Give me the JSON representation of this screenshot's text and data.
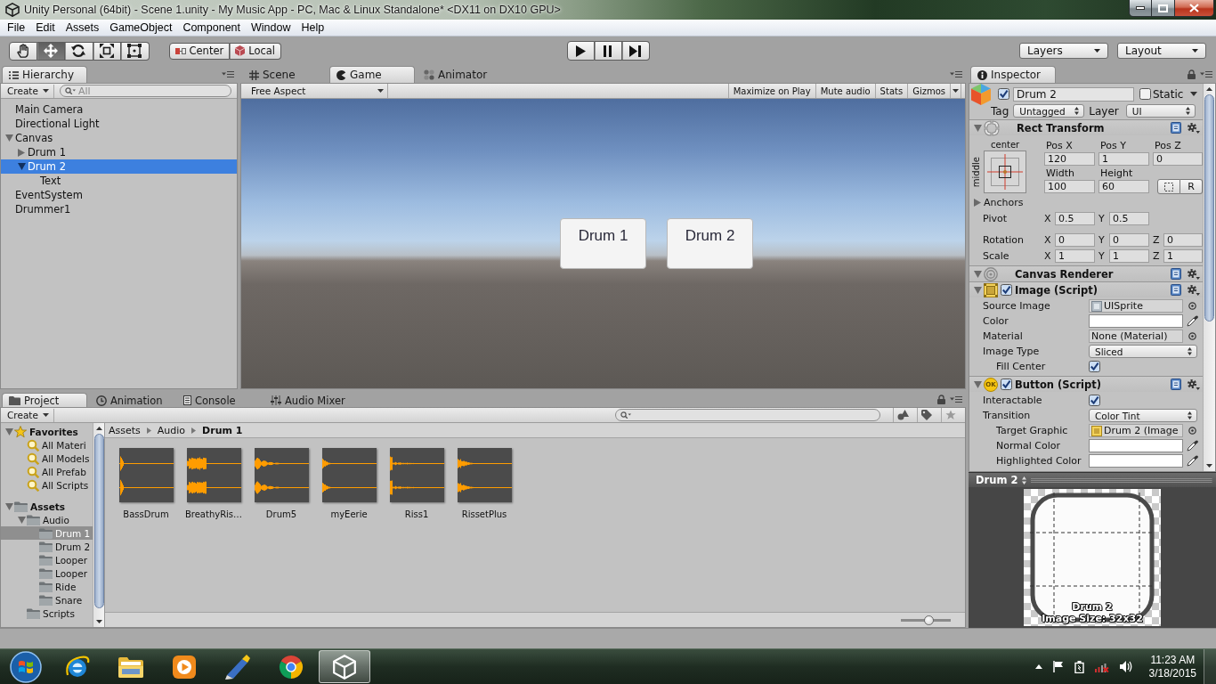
{
  "window": {
    "title": "Unity Personal (64bit) - Scene 1.unity - My Music App - PC, Mac & Linux Standalone* <DX11 on DX10 GPU>"
  },
  "menu_bar": [
    "File",
    "Edit",
    "Assets",
    "GameObject",
    "Component",
    "Window",
    "Help"
  ],
  "toolbar": {
    "tools": [
      {
        "kind": "hand",
        "selected": false
      },
      {
        "kind": "move",
        "selected": true
      },
      {
        "kind": "rotate",
        "selected": false
      },
      {
        "kind": "scale",
        "selected": false
      },
      {
        "kind": "rect",
        "selected": false
      }
    ],
    "pivot_mode": "Center",
    "pivot_rotation": "Local",
    "playback": [
      {
        "kind": "play"
      },
      {
        "kind": "pause"
      },
      {
        "kind": "step"
      }
    ],
    "layers": "Layers",
    "layout": "Layout"
  },
  "hierarchy": {
    "tab": "Hierarchy",
    "create": "Create",
    "search": {
      "placeholder": "All"
    },
    "items": [
      {
        "label": "Main Camera",
        "selected": false
      },
      {
        "label": "Directional Light",
        "selected": false
      },
      {
        "label": "Canvas",
        "selected": false,
        "expanded": true,
        "children": [
          {
            "label": "Drum 1",
            "selected": false,
            "expanded": false
          },
          {
            "label": "Drum 2",
            "selected": true,
            "expanded": true,
            "children": [
              {
                "label": "Text",
                "selected": false
              }
            ]
          }
        ]
      },
      {
        "label": "EventSystem",
        "selected": false
      },
      {
        "label": "Drummer1",
        "selected": false
      }
    ]
  },
  "center_panel": {
    "tabs": [
      {
        "kind": "scene",
        "label": "Scene",
        "selected": false
      },
      {
        "kind": "game",
        "label": "Game",
        "selected": true
      },
      {
        "kind": "animator",
        "label": "Animator",
        "selected": false
      }
    ],
    "aspect": "Free Aspect",
    "options": [
      "Maximize on Play",
      "Mute audio",
      "Stats",
      "Gizmos"
    ],
    "game_buttons": [
      "Drum 1",
      "Drum 2"
    ]
  },
  "inspector": {
    "tab": "Inspector",
    "object": {
      "active": true,
      "name": "Drum 2",
      "static": false,
      "static_label": "Static",
      "tag_label": "Tag",
      "tag": "Untagged",
      "layer_label": "Layer",
      "layer": "UI"
    },
    "rect_transform": {
      "title": "Rect Transform",
      "expanded": true,
      "anchor_horizontal": "center",
      "anchor_vertical": "middle",
      "pos_fields": [
        {
          "label": "Pos X",
          "value": "120"
        },
        {
          "label": "Pos Y",
          "value": "1"
        },
        {
          "label": "Pos Z",
          "value": "0"
        }
      ],
      "size_fields": [
        {
          "label": "Width",
          "value": "100"
        },
        {
          "label": "Height",
          "value": "60"
        }
      ],
      "raw_button": "R",
      "anchors": {
        "label": "Anchors",
        "expanded": false
      },
      "vectors": [
        {
          "label": "Pivot",
          "fields": [
            {
              "axis": "X",
              "value": "0.5"
            },
            {
              "axis": "Y",
              "value": "0.5"
            }
          ]
        },
        {
          "label": "Rotation",
          "fields": [
            {
              "axis": "X",
              "value": "0"
            },
            {
              "axis": "Y",
              "value": "0"
            },
            {
              "axis": "Z",
              "value": "0"
            }
          ]
        },
        {
          "label": "Scale",
          "fields": [
            {
              "axis": "X",
              "value": "1"
            },
            {
              "axis": "Y",
              "value": "1"
            },
            {
              "axis": "Z",
              "value": "1"
            }
          ]
        }
      ]
    },
    "components": [
      {
        "kind": "canvas_renderer",
        "title": "Canvas Renderer",
        "expanded": true
      },
      {
        "kind": "image",
        "title": "Image (Script)",
        "expanded": true,
        "enabled": true,
        "properties": [
          {
            "kind": "sprite",
            "label": "Source Image",
            "value": "UISprite"
          },
          {
            "kind": "color",
            "label": "Color",
            "color": "#ffffff"
          },
          {
            "kind": "object",
            "label": "Material",
            "value": "None (Material)"
          },
          {
            "kind": "dropdown",
            "label": "Image Type",
            "value": "Sliced",
            "children": [
              {
                "kind": "checkbox",
                "label": "Fill Center",
                "checked": true
              }
            ]
          }
        ]
      },
      {
        "kind": "button",
        "title": "Button (Script)",
        "badge": "OK",
        "expanded": true,
        "enabled": true,
        "properties": [
          {
            "kind": "checkbox",
            "label": "Interactable",
            "checked": true
          },
          {
            "kind": "dropdown",
            "label": "Transition",
            "value": "Color Tint",
            "children": [
              {
                "kind": "reference",
                "label": "Target Graphic",
                "value": "Drum 2 (Image"
              },
              {
                "kind": "color",
                "label": "Normal Color",
                "color": "#ffffff"
              },
              {
                "kind": "color",
                "label": "Highlighted Color",
                "color": "#ffffff"
              }
            ]
          }
        ]
      }
    ]
  },
  "preview": {
    "title": "Drum 2",
    "image_name": "Drum 2",
    "image_size": "Image Size: 32x32"
  },
  "project": {
    "tabs": [
      {
        "kind": "project",
        "label": "Project",
        "selected": true
      },
      {
        "kind": "animation",
        "label": "Animation",
        "selected": false
      },
      {
        "kind": "console",
        "label": "Console",
        "selected": false
      },
      {
        "kind": "audio_mixer",
        "label": "Audio Mixer",
        "selected": false
      }
    ],
    "create": "Create",
    "tree": [
      {
        "label": "Favorites",
        "kind": "favorites",
        "selected": false,
        "expanded": true,
        "children": [
          {
            "label": "All Materi",
            "kind": "saved_search",
            "selected": false
          },
          {
            "label": "All Models",
            "kind": "saved_search",
            "selected": false
          },
          {
            "label": "All Prefab",
            "kind": "saved_search",
            "selected": false
          },
          {
            "label": "All Scripts",
            "kind": "saved_search",
            "selected": false
          }
        ]
      },
      {
        "label": "Assets",
        "kind": "folder",
        "selected": false,
        "expanded": true,
        "children": [
          {
            "label": "Audio",
            "kind": "folder",
            "selected": false,
            "expanded": true,
            "children": [
              {
                "label": "Drum 1",
                "kind": "folder",
                "selected": true
              },
              {
                "label": "Drum 2",
                "kind": "folder",
                "selected": false
              },
              {
                "label": "Looper",
                "kind": "folder",
                "selected": false
              },
              {
                "label": "Looper",
                "kind": "folder",
                "selected": false
              },
              {
                "label": "Ride",
                "kind": "folder",
                "selected": false
              },
              {
                "label": "Snare",
                "kind": "folder",
                "selected": false
              }
            ]
          },
          {
            "label": "Scripts",
            "kind": "folder",
            "selected": false
          }
        ]
      }
    ],
    "breadcrumb": [
      "Assets",
      "Audio",
      "Drum 1"
    ],
    "assets": [
      "BassDrum",
      "BreathyRis…",
      "Drum5",
      "myEerie",
      "Riss1",
      "RissetPlus"
    ],
    "zoom_slider": {
      "level": 0.58
    }
  },
  "taskbar": {
    "apps": [
      {
        "kind": "web_browser",
        "selected": false
      },
      {
        "kind": "file_explorer",
        "selected": false
      },
      {
        "kind": "media_player",
        "selected": false
      },
      {
        "kind": "drawing_app",
        "selected": false
      },
      {
        "kind": "round_browser",
        "selected": false
      },
      {
        "kind": "game_engine",
        "selected": true
      }
    ],
    "time": "11:23 AM",
    "date": "3/18/2015"
  }
}
